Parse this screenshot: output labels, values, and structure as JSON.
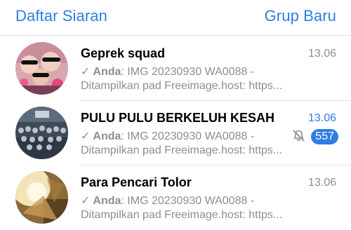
{
  "header": {
    "left_label": "Daftar Siaran",
    "right_label": "Grup Baru"
  },
  "colors": {
    "accent": "#2f7de1",
    "secondary_text": "#8e8e93",
    "separator": "#e5e5ea"
  },
  "chats": [
    {
      "name": "Geprek squad",
      "time": "13.06",
      "check_icon": "single-check-icon",
      "sender": "Anda",
      "preview_line1": ": IMG 20230930 WA0088 -",
      "preview_line2": "Ditampilkan pad Freeimage.host: https...",
      "unread": false
    },
    {
      "name": "PULU PULU BERKELUH KESAH",
      "time": "13.06",
      "check_icon": "single-check-icon",
      "sender": "Anda",
      "preview_line1": ": IMG 20230930 WA0088 -",
      "preview_line2": "Ditampilkan pad Freeimage.host: https...",
      "unread": true,
      "muted": true,
      "mute_icon": "bell-muted-icon",
      "badge": "557"
    },
    {
      "name": "Para Pencari Tolor",
      "time": "13.06",
      "check_icon": "single-check-icon",
      "sender": "Anda",
      "preview_line1": ": IMG 20230930 WA0088 -",
      "preview_line2": "Ditampilkan pad Freeimage.host: https...",
      "unread": false
    }
  ]
}
